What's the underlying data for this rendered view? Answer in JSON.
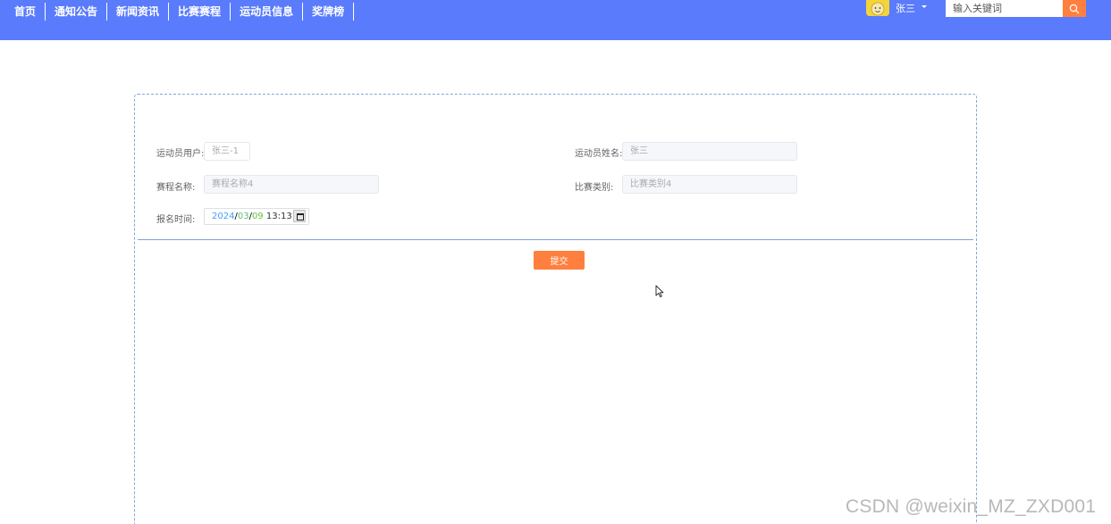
{
  "nav": {
    "items": [
      {
        "label": "首页"
      },
      {
        "label": "通知公告"
      },
      {
        "label": "新闻资讯"
      },
      {
        "label": "比赛赛程"
      },
      {
        "label": "运动员信息"
      },
      {
        "label": "奖牌榜"
      }
    ]
  },
  "user": {
    "name": "张三"
  },
  "search": {
    "placeholder": "输入关键词"
  },
  "form": {
    "athlete_user_label": "运动员用户:",
    "athlete_user_value": "张三-1",
    "athlete_name_label": "运动员姓名:",
    "athlete_name_value": "张三",
    "schedule_name_label": "赛程名称:",
    "schedule_name_value": "赛程名称4",
    "category_label": "比赛类别:",
    "category_value": "比赛类别4",
    "signup_time_label": "报名时间:",
    "signup_time": {
      "year": "2024",
      "month": "03",
      "day": "09",
      "time": "13:13"
    },
    "submit_label": "提交"
  },
  "watermark": "CSDN @weixin_MZ_ZXD001",
  "colors": {
    "topbar": "#5a7bfb",
    "accent": "#ff7f3e"
  }
}
